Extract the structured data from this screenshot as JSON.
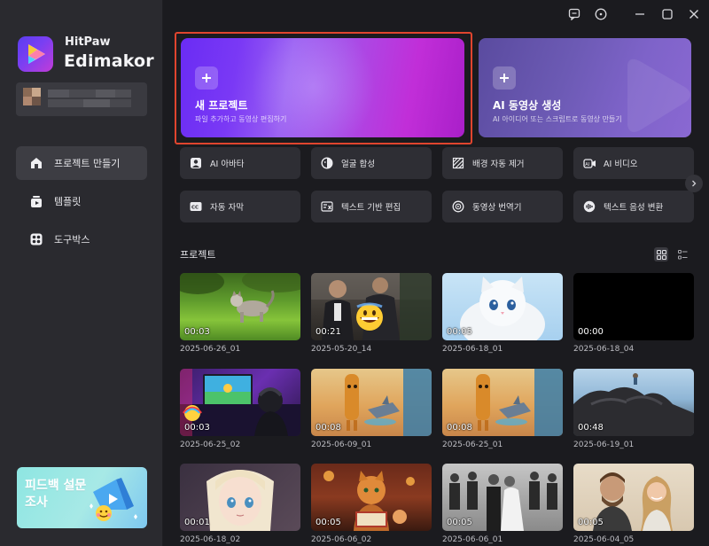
{
  "app": {
    "brand_small": "HitPaw",
    "brand_big": "Edimakor"
  },
  "sidebar": {
    "items": [
      {
        "label": "프로젝트 만들기",
        "icon": "home-icon",
        "active": true
      },
      {
        "label": "템플릿",
        "icon": "template-icon",
        "active": false
      },
      {
        "label": "도구박스",
        "icon": "toolbox-icon",
        "active": false
      }
    ],
    "banner_text": "피드백 설문조사"
  },
  "titlebar": {
    "icons": [
      "feedback-icon",
      "info-icon",
      "minimize-icon",
      "maximize-icon",
      "close-icon"
    ]
  },
  "hero": {
    "new_project": {
      "title": "새 프로젝트",
      "subtitle": "파일 추가하고 동영상 편집하기"
    },
    "ai_video": {
      "title": "AI 동영상 생성",
      "subtitle": "AI 아이디어 또는 스크립트로 동영상 만들기"
    }
  },
  "tools": [
    {
      "label": "AI 아바타",
      "icon": "avatar-icon"
    },
    {
      "label": "얼굴 합성",
      "icon": "face-swap-icon"
    },
    {
      "label": "배경 자동 제거",
      "icon": "background-remove-icon"
    },
    {
      "label": "AI 비디오",
      "icon": "ai-video-icon"
    },
    {
      "label": "자동 자막",
      "icon": "subtitle-icon"
    },
    {
      "label": "텍스트 기반 편집",
      "icon": "text-edit-icon"
    },
    {
      "label": "동영상 번역기",
      "icon": "translate-icon"
    },
    {
      "label": "텍스트 음성 변환",
      "icon": "text-to-speech-icon"
    }
  ],
  "projects": {
    "title": "프로젝트",
    "view_icons": [
      "grid-view-icon",
      "list-view-icon"
    ],
    "items": [
      {
        "name": "2025-06-26_01",
        "duration": "00:03"
      },
      {
        "name": "2025-05-20_14",
        "duration": "00:21"
      },
      {
        "name": "2025-06-18_01",
        "duration": "00:05"
      },
      {
        "name": "2025-06-18_04",
        "duration": "00:00"
      },
      {
        "name": "2025-06-25_02",
        "duration": "00:03"
      },
      {
        "name": "2025-06-09_01",
        "duration": "00:08"
      },
      {
        "name": "2025-06-25_01",
        "duration": "00:08"
      },
      {
        "name": "2025-06-19_01",
        "duration": "00:48"
      },
      {
        "name": "2025-06-18_02",
        "duration": "00:01"
      },
      {
        "name": "2025-06-06_02",
        "duration": "00:05"
      },
      {
        "name": "2025-06-06_01",
        "duration": "00:05"
      },
      {
        "name": "2025-06-04_05",
        "duration": "00:05"
      }
    ]
  }
}
